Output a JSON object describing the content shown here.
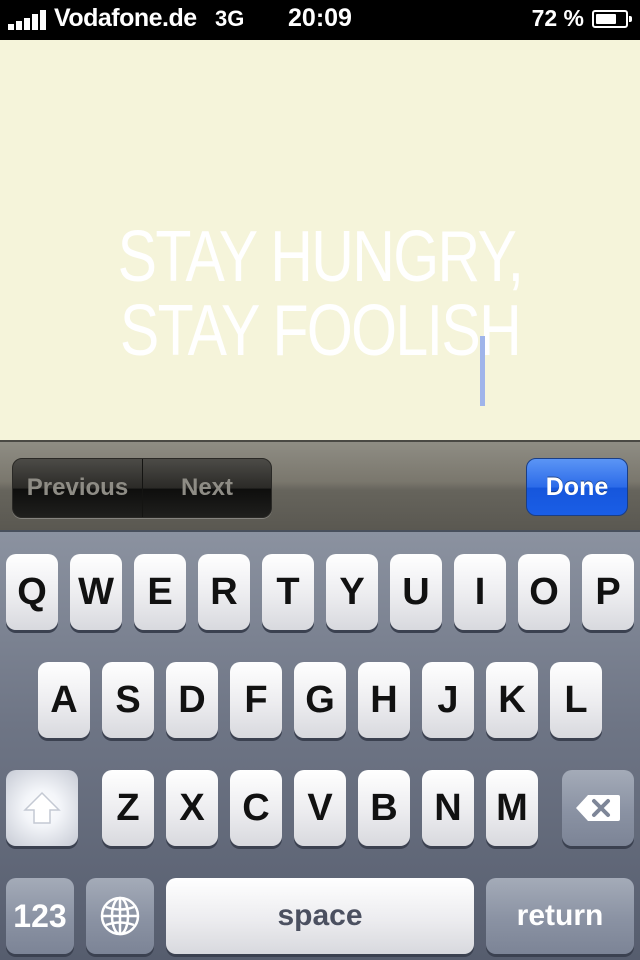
{
  "status_bar": {
    "carrier": "Vodafone.de",
    "network": "3G",
    "time": "20:09",
    "battery_percent": "72 %",
    "battery_level": 0.72,
    "signal_bars": 5
  },
  "note": {
    "line1": "STAY HUNGRY,",
    "line2": "STAY FOOLISH",
    "background_color": "#f5f4da"
  },
  "accessory_bar": {
    "previous_label": "Previous",
    "next_label": "Next",
    "done_label": "Done"
  },
  "keyboard": {
    "row1": [
      "Q",
      "W",
      "E",
      "R",
      "T",
      "Y",
      "U",
      "I",
      "O",
      "P"
    ],
    "row2": [
      "A",
      "S",
      "D",
      "F",
      "G",
      "H",
      "J",
      "K",
      "L"
    ],
    "row3": [
      "Z",
      "X",
      "C",
      "V",
      "B",
      "N",
      "M"
    ],
    "numbers_label": "123",
    "space_label": "space",
    "return_label": "return",
    "shift_icon": "shift-arrow-icon",
    "delete_icon": "backspace-icon",
    "globe_icon": "globe-icon"
  }
}
